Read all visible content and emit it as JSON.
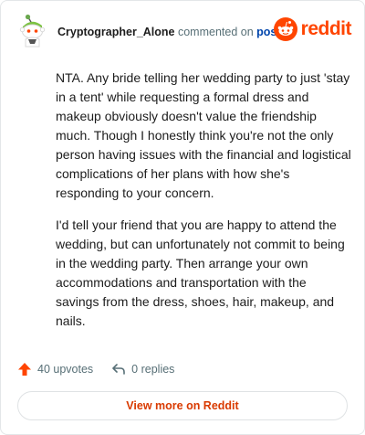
{
  "comment": {
    "username": "Cryptographer_Alone",
    "commented_on": "commented on",
    "post_link": "post",
    "avatar": "snoo-avatar",
    "paragraphs": [
      "NTA. Any bride telling her wedding party to just 'stay in a tent' while requesting a formal dress and makeup obviously doesn't value the friendship much. Though I honestly think you're not the only person having issues with the financial and logistical complications of her plans with how she's responding to your concern.",
      "I'd tell your friend that you are happy to attend the wedding, but can unfortunately not commit to being in the wedding party. Then arrange your own accommodations and transportation with the savings from the dress, shoes, hair, makeup, and nails."
    ],
    "upvotes": "40 upvotes",
    "replies": "0 replies"
  },
  "brand": {
    "wordmark": "reddit",
    "color": "#ff4500"
  },
  "actions": {
    "view_more": "View more on Reddit"
  },
  "colors": {
    "link": "#0045ac",
    "muted": "#576f76",
    "cta": "#d93a00",
    "upvote": "#ff4500"
  }
}
